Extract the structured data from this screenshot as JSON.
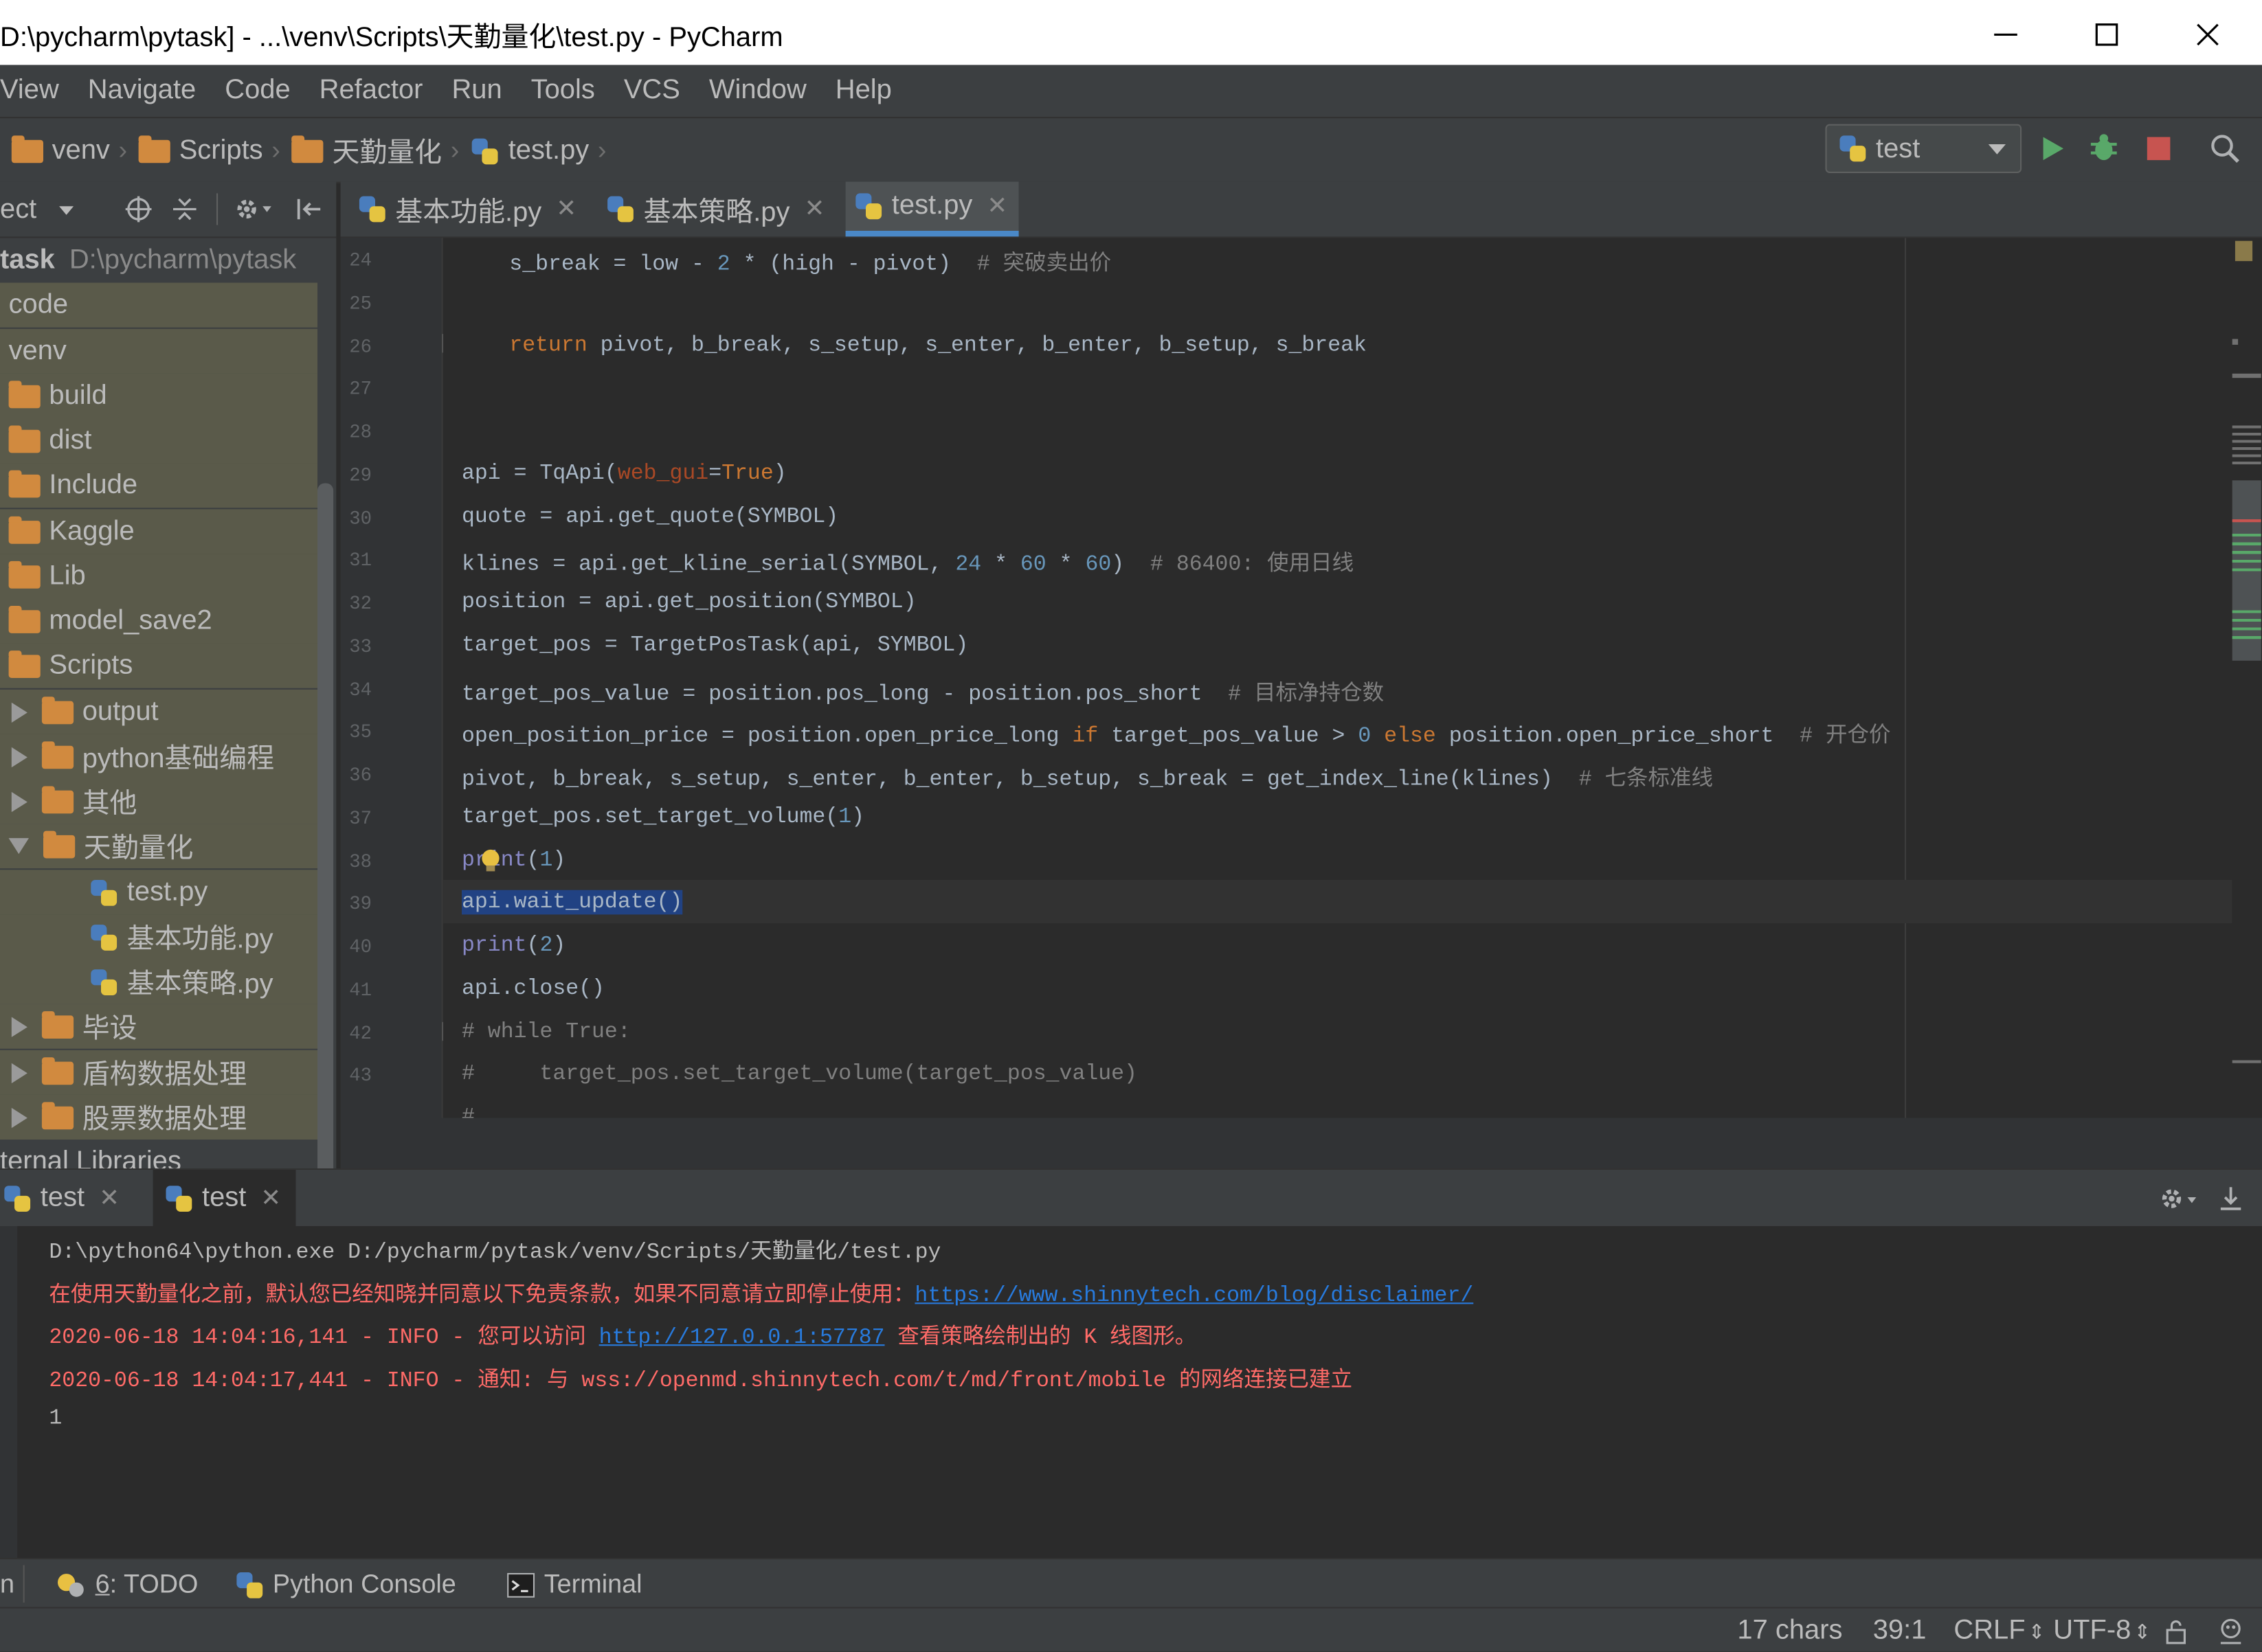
{
  "window": {
    "title": "D:\\pycharm\\pytask] - ...\\venv\\Scripts\\天勤量化\\test.py - PyCharm"
  },
  "menu": [
    "View",
    "Navigate",
    "Code",
    "Refactor",
    "Run",
    "Tools",
    "VCS",
    "Window",
    "Help"
  ],
  "breadcrumbs": [
    "venv",
    "Scripts",
    "天勤量化",
    "test.py"
  ],
  "run_config": {
    "selected": "test"
  },
  "project_panel": {
    "header": "ect",
    "root_name": "task",
    "root_path": "D:\\pycharm\\pytask",
    "items": [
      {
        "label": "code"
      },
      {
        "label": "venv"
      },
      {
        "label": "build"
      },
      {
        "label": "dist"
      },
      {
        "label": "Include"
      },
      {
        "label": "Kaggle"
      },
      {
        "label": "Lib"
      },
      {
        "label": "model_save2"
      },
      {
        "label": "Scripts"
      },
      {
        "label": "output"
      },
      {
        "label": "python基础编程"
      },
      {
        "label": "其他"
      },
      {
        "label": "天勤量化"
      },
      {
        "label": "test.py"
      },
      {
        "label": "基本功能.py"
      },
      {
        "label": "基本策略.py"
      },
      {
        "label": "毕设"
      },
      {
        "label": "盾构数据处理"
      },
      {
        "label": "股票数据处理"
      },
      {
        "label": "ternal Libraries"
      }
    ]
  },
  "editor_tabs": [
    "基本功能.py",
    "基本策略.py",
    "test.py"
  ],
  "editor": {
    "line_numbers": [
      "24",
      "25",
      "26",
      "27",
      "28",
      "29",
      "30",
      "31",
      "32",
      "33",
      "34",
      "35",
      "36",
      "37",
      "38",
      "39",
      "40",
      "41",
      "42",
      "43"
    ]
  },
  "run_panel": {
    "tabs": [
      "test",
      "test"
    ],
    "console": {
      "line1": "D:\\python64\\python.exe D:/pycharm/pytask/venv/Scripts/天勤量化/test.py",
      "line2_text": "在使用天勤量化之前，默认您已经知晓并同意以下免责条款，如果不同意请立即停止使用：",
      "line2_link": "https://www.shinnytech.com/blog/disclaimer/",
      "line3_text": "2020-06-18 14:04:16,141 - INFO - 您可以访问 ",
      "line3_link": "http://127.0.0.1:57787",
      "line3_tail": " 查看策略绘制出的 K 线图形。",
      "line4": "2020-06-18 14:04:17,441 - INFO - 通知: 与 wss://openmd.shinnytech.com/t/md/front/mobile 的网络连接已建立",
      "line5": "1"
    }
  },
  "tool_windows": {
    "left_edge": "n",
    "todo_prefix": "6",
    "todo_label": ": TODO",
    "python_console": "Python Console",
    "terminal": "Terminal"
  },
  "status": {
    "chars": "17 chars",
    "position": "39:1",
    "line_sep": "CRLF",
    "encoding": "UTF-8"
  }
}
